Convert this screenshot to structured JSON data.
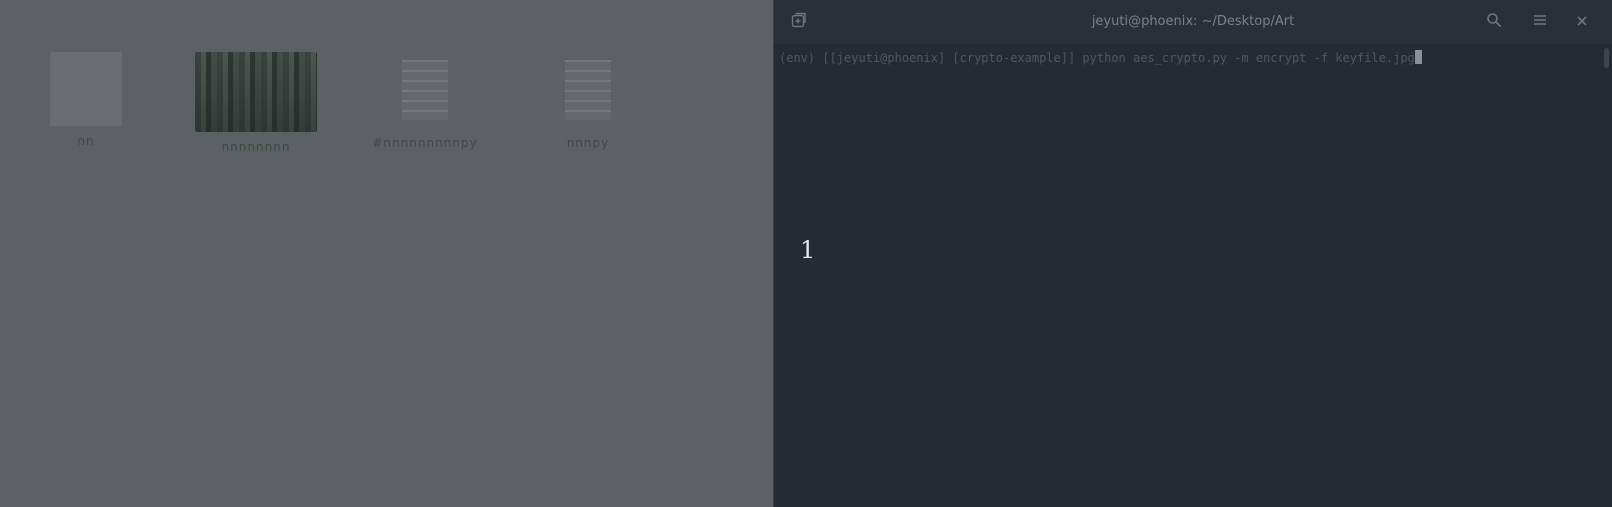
{
  "desktop": {
    "items": [
      {
        "label": "nn",
        "type": "folder"
      },
      {
        "label": "nnnnnnnn",
        "type": "photo"
      },
      {
        "label": "#nnnnnnnnnpy",
        "type": "doc"
      },
      {
        "label": "nnnpy",
        "type": "doc"
      }
    ]
  },
  "terminal": {
    "title": "jeyuti@phoenix: ~/Desktop/Art",
    "prompt": "(env) [[jeyuti@phoenix] [crypto-example]] python aes_crypto.py -m encrypt -f keyfile.jpg",
    "overlay_number": "1",
    "icons": {
      "new_tab": "new-tab-icon",
      "search": "search-icon",
      "menu": "hamburger-menu-icon",
      "close": "close-icon"
    }
  }
}
